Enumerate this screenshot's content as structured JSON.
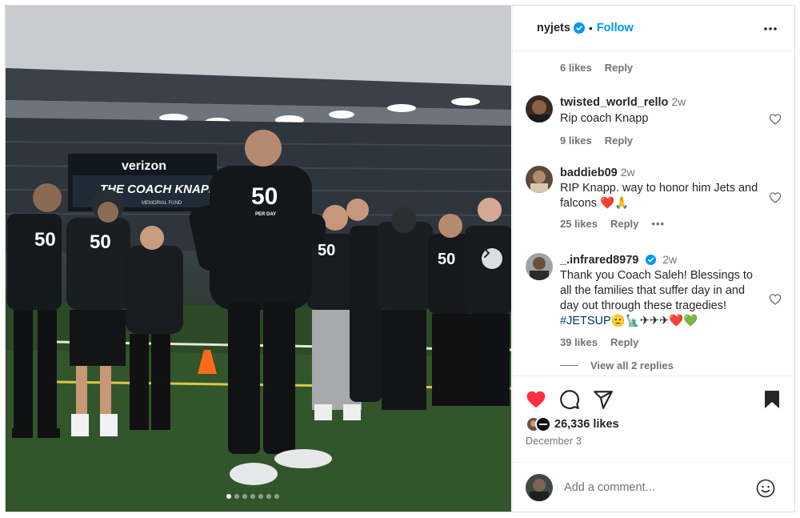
{
  "post": {
    "image_alt": "",
    "shirt_number": "50",
    "shirt_sub": "PER DAY",
    "shirt_logo": "THE COACH KNAPP",
    "scoreboard_brand": "verizon",
    "scoreboard_text": "THE COACH KNAPP",
    "scoreboard_sub": "MEMORIAL FUND",
    "carousel_dots": 7,
    "active_dot": 0
  },
  "header": {
    "username": "nyjets",
    "separator": "•",
    "follow_label": "Follow",
    "more_icon": "more-horizontal-icon"
  },
  "comments": {
    "top_meta": {
      "likes": "6 likes",
      "reply": "Reply"
    },
    "items": [
      {
        "username": "twisted_world_rello",
        "time": "2w",
        "text": "Rip coach Knapp",
        "likes": "9 likes",
        "reply": "Reply"
      },
      {
        "username": "baddieb09",
        "time": "2w",
        "text": "RIP Knapp. way to honor him Jets and falcons ❤️🙏",
        "likes": "25 likes",
        "reply": "Reply",
        "more": "•••"
      },
      {
        "username": "_.infrared8979",
        "time": "2w",
        "text": "Thank you Coach Saleh! Blessings to all the families that suffer day in and day out through these tragedies!",
        "hashtag": "#JETSUP",
        "emojis": "🫡🗽✈✈✈❤️💚",
        "likes": "39 likes",
        "reply": "Reply"
      }
    ],
    "view_all": "View all 2 replies"
  },
  "actions": {
    "likes": "26,336 likes",
    "date": "December 3",
    "icons": [
      "heart-icon",
      "comment-icon",
      "share-icon",
      "bookmark-icon"
    ]
  },
  "add_comment": {
    "placeholder": "Add a comment..."
  },
  "colors": {
    "accent": "#0095f6",
    "like_red": "#ff3040",
    "text": "#262626",
    "muted": "#737373"
  }
}
